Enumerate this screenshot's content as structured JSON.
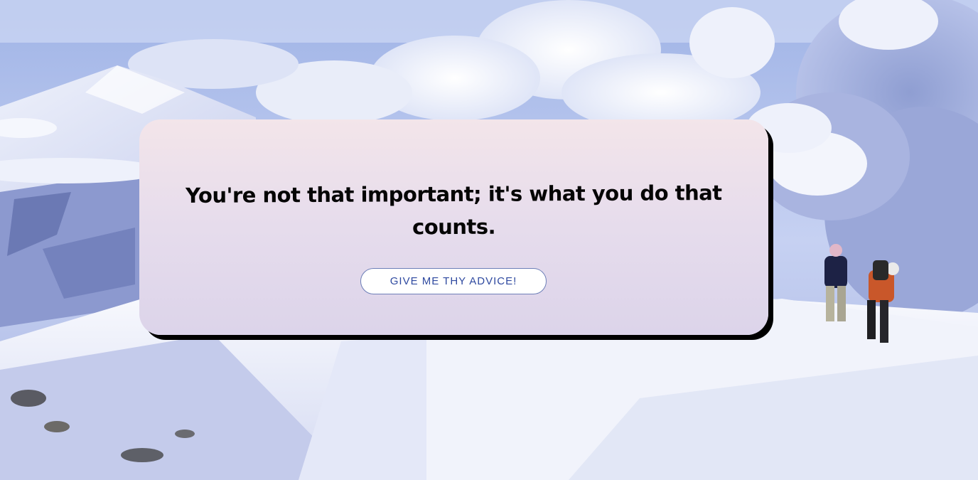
{
  "background": {
    "description_icon": "snowy-mountain-ridge-image"
  },
  "quote": {
    "text": "You're not that important; it's what you do that counts."
  },
  "button": {
    "label": "GIVE ME THY ADVICE!"
  },
  "colors": {
    "card_top": "#f3e5ea",
    "card_bottom": "#dcd4ea",
    "shadow": "#000000",
    "button_text": "#2f4aa0",
    "button_border": "#6d7fb8"
  }
}
